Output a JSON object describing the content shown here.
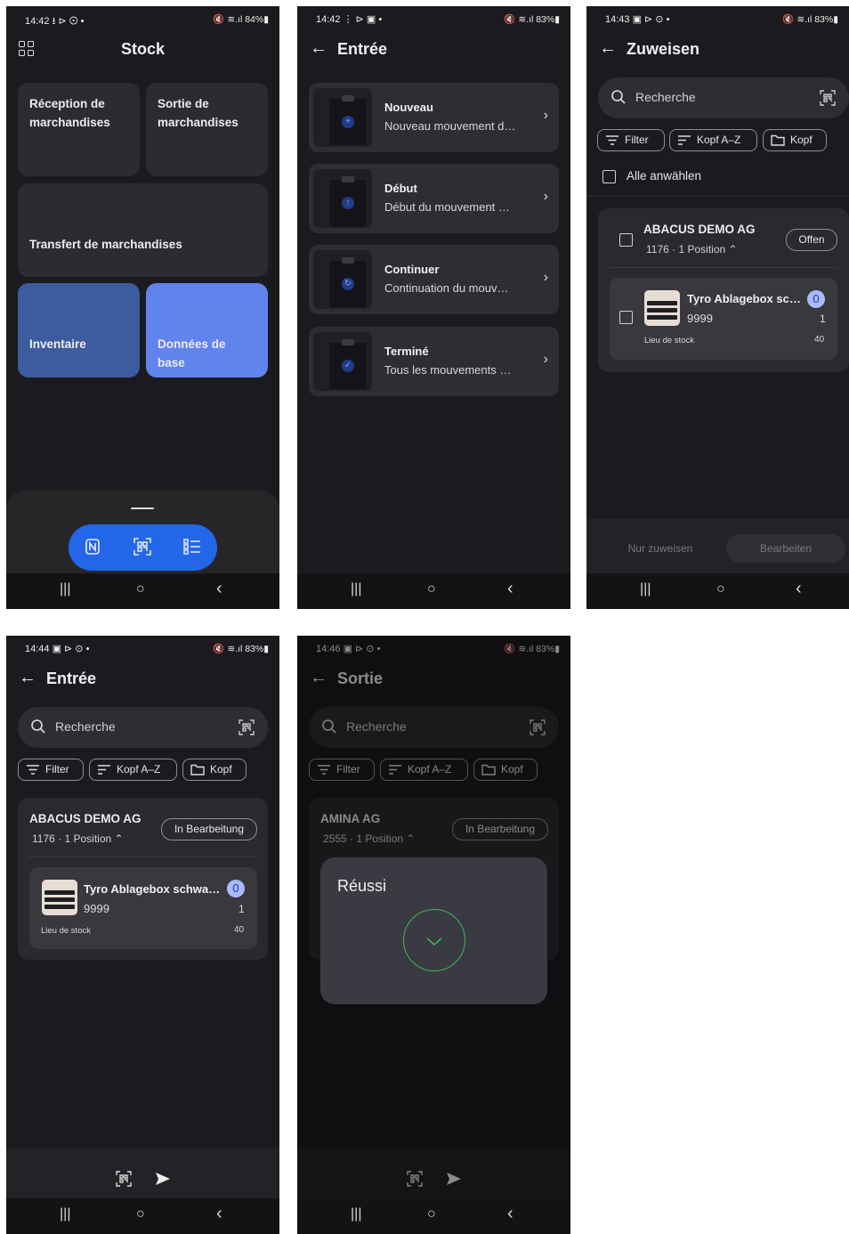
{
  "colors": {
    "background": "#1b1b1f",
    "accent": "#2367e8",
    "tile_blue_dark": "#3d5b9f",
    "tile_blue_light": "#6183ee",
    "success": "#3fb55a"
  },
  "screen1": {
    "status": {
      "time": "14:42 ⭳ ⊳ ⊙ •",
      "right": "🔇 ≋.ıl 84%▮"
    },
    "title": "Stock",
    "tiles": [
      {
        "label": "Réception de marchandises"
      },
      {
        "label": "Sortie de marchandises"
      },
      {
        "label": "Transfert de marchandises"
      },
      {
        "label": "Inventaire"
      },
      {
        "label": "Données de base"
      }
    ],
    "bottom_icons": [
      "nfc-icon",
      "qr-scan-icon",
      "list-icon"
    ]
  },
  "screen2": {
    "status": {
      "time": "14:42 ⋮ ⊳ ▣ •",
      "right": "🔇 ≋.ıl 83%▮"
    },
    "title": "Entrée",
    "items": [
      {
        "title": "Nouveau",
        "subtitle": "Nouveau mouvement d…",
        "icon": "plus-icon"
      },
      {
        "title": "Début",
        "subtitle": "Début du mouvement …",
        "icon": "arrow-up-icon"
      },
      {
        "title": "Continuer",
        "subtitle": "Continuation du mouv…",
        "icon": "sync-icon"
      },
      {
        "title": "Terminé",
        "subtitle": "Tous les mouvements …",
        "icon": "check-icon"
      }
    ]
  },
  "screen3": {
    "status": {
      "time": "14:43 ▣ ⊳ ⊙ •",
      "right": "🔇 ≋.ıl 83%▮"
    },
    "title": "Zuweisen",
    "search_placeholder": "Recherche",
    "chips": [
      "Filter",
      "Kopf A–Z",
      "Kopf"
    ],
    "select_all": "Alle anwählen",
    "order": {
      "name": "ABACUS DEMO AG",
      "sub": "1176 · 1 Position ⌃",
      "status": "Offen"
    },
    "item": {
      "name": "Tyro Ablagebox sc…",
      "code": "9999",
      "count": "0",
      "qty": "1",
      "location_label": "Lieu de stock",
      "location_value": "40"
    },
    "actions": {
      "assign": "Nur zuweisen",
      "edit": "Bearbeiten"
    }
  },
  "screen4": {
    "status": {
      "time": "14:44 ▣ ⊳ ⊙ •",
      "right": "🔇 ≋.ıl 83%▮"
    },
    "title": "Entrée",
    "search_placeholder": "Recherche",
    "chips": [
      "Filter",
      "Kopf A–Z",
      "Kopf"
    ],
    "order": {
      "name": "ABACUS DEMO AG",
      "sub": "1176 · 1 Position ⌃",
      "status": "In Bearbeitung"
    },
    "item": {
      "name": "Tyro Ablagebox schwa…",
      "code": "9999",
      "count": "0",
      "qty": "1",
      "location_label": "Lieu de stock",
      "location_value": "40"
    }
  },
  "screen5": {
    "status": {
      "time": "14:46 ▣ ⊳ ⊙ •",
      "right": "🔇 ≋.ıl 83%▮"
    },
    "title": "Sortie",
    "search_placeholder": "Recherche",
    "chips": [
      "Filter",
      "Kopf A–Z",
      "Kopf"
    ],
    "order": {
      "name": "AMINA AG",
      "sub": "2555 · 1 Position ⌃",
      "status": "In Bearbeitung"
    },
    "dialog": {
      "title": "Réussi"
    }
  },
  "navbar": {
    "recents": "|||",
    "home": "○",
    "back": "‹"
  }
}
